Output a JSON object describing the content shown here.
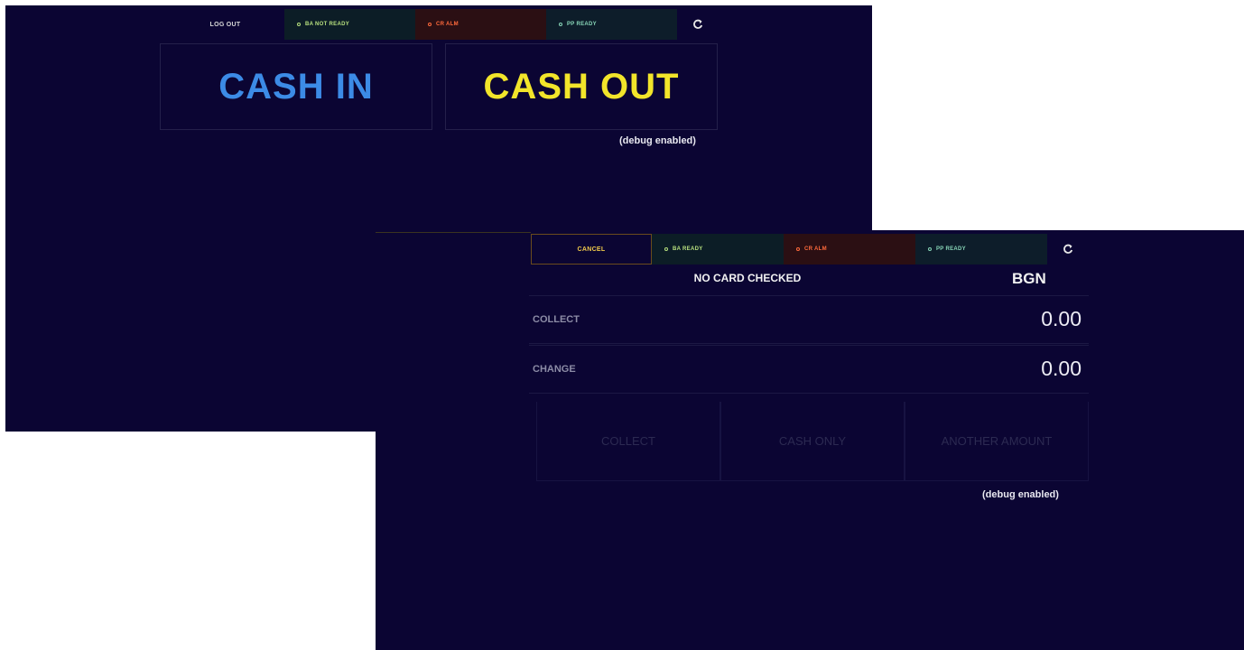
{
  "screen_a": {
    "statusbar": {
      "logout_label": "LOG OUT",
      "status_1": "BA NOT READY",
      "status_2": "CR ALM",
      "status_3": "PP READY",
      "refresh_icon": "refresh-icon"
    },
    "cash_in_label": "CASH IN",
    "cash_out_label": "CASH OUT",
    "debug_text": "(debug enabled)"
  },
  "screen_b": {
    "statusbar": {
      "cancel_label": "CANCEL",
      "status_1": "BA READY",
      "status_2": "CR ALM",
      "status_3": "PP READY",
      "refresh_icon": "refresh-icon"
    },
    "card_status": "NO CARD CHECKED",
    "currency": "BGN",
    "collect": {
      "label": "COLLECT",
      "value": "0.00"
    },
    "change": {
      "label": "CHANGE",
      "value": "0.00"
    },
    "actions": [
      "COLLECT",
      "CASH ONLY",
      "ANOTHER AMOUNT"
    ],
    "debug_text": "(debug enabled)"
  },
  "colors": {
    "background": "#0b0533",
    "cash_in": "#3c8be6",
    "cash_out": "#f2e52a",
    "cancel": "#f0c94a"
  }
}
